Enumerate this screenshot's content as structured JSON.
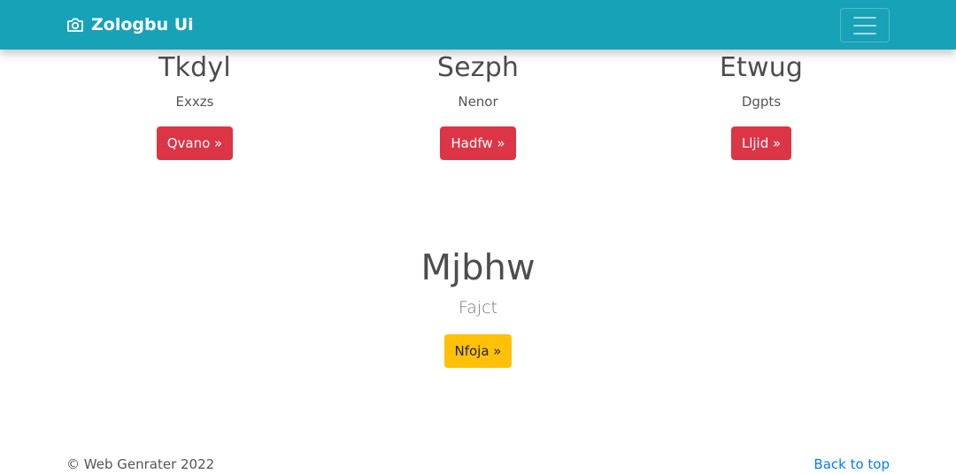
{
  "navbar": {
    "brand_icon": "camera-icon",
    "brand_label": "Zologbu Ui",
    "toggler_icon": "hamburger-menu-icon",
    "background_color": "#17a2b8"
  },
  "columns": [
    {
      "title": "Tkdyl",
      "text": "Exxzs",
      "button_label": "Qvano »"
    },
    {
      "title": "Sezph",
      "text": "Nenor",
      "button_label": "Hadfw »"
    },
    {
      "title": "Etwug",
      "text": "Dgpts",
      "button_label": "Lljid »"
    }
  ],
  "hero": {
    "title": "Mjbhw",
    "text": "Fajct",
    "button_label": "Nfoja »"
  },
  "footer": {
    "copyright": "© Web Genrater 2022",
    "back_to_top": "Back to top"
  },
  "colors": {
    "danger": "#dc3545",
    "warning": "#ffc107",
    "link": "#007bff"
  }
}
